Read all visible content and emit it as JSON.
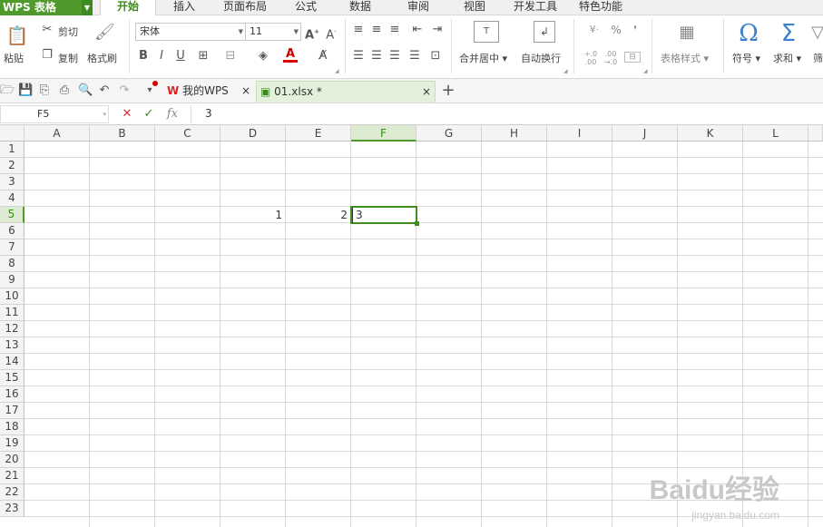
{
  "app": {
    "name": "WPS 表格"
  },
  "ribbon_tabs": [
    "开始",
    "插入",
    "页面布局",
    "公式",
    "数据",
    "审阅",
    "视图",
    "开发工具",
    "特色功能"
  ],
  "active_tab": "开始",
  "clipboard": {
    "paste": "粘贴",
    "cut": "剪切",
    "copy": "复制",
    "format_painter": "格式刷"
  },
  "font": {
    "name": "宋体",
    "size": "11",
    "bold": "B",
    "italic": "I",
    "underline": "U"
  },
  "alignment": {
    "merge_center": "合并居中",
    "wrap_text": "自动换行"
  },
  "number": {
    "percent": "%",
    "comma": "❜",
    "increase_decimal": "+.0 .00",
    "decrease_decimal": ".00 →.0"
  },
  "styles": {
    "table_style": "表格样式"
  },
  "insert": {
    "symbol": "符号",
    "sum": "求和",
    "filter": "筛"
  },
  "quick_access": {
    "my_wps_tab": "我的WPS",
    "file_tab": "01.xlsx *",
    "new_tab": "+"
  },
  "formula_bar": {
    "name_box": "F5",
    "cancel": "✕",
    "enter": "✓",
    "fx": "fx",
    "content": "3"
  },
  "columns": [
    "A",
    "B",
    "C",
    "D",
    "E",
    "F",
    "G",
    "H",
    "I",
    "J",
    "K",
    "L"
  ],
  "column_last_partial": "",
  "rows": [
    "1",
    "2",
    "3",
    "4",
    "5",
    "6",
    "7",
    "8",
    "9",
    "10",
    "11",
    "12",
    "13",
    "14",
    "15",
    "16",
    "17",
    "18",
    "19",
    "20",
    "21",
    "22",
    "23"
  ],
  "selected_cell": "F5",
  "cells": [
    {
      "ref": "D5",
      "value": "1",
      "align": "right"
    },
    {
      "ref": "E5",
      "value": "2",
      "align": "right"
    },
    {
      "ref": "F5",
      "value": "3",
      "align": "left",
      "editing": true
    }
  ],
  "watermark": {
    "brand": "Baidu经验",
    "url": "jingyan.baidu.com"
  },
  "colors": {
    "accent": "#4f9a2a",
    "selection_border": "#3e8f1f",
    "header_bg": "#f4f4f4"
  }
}
